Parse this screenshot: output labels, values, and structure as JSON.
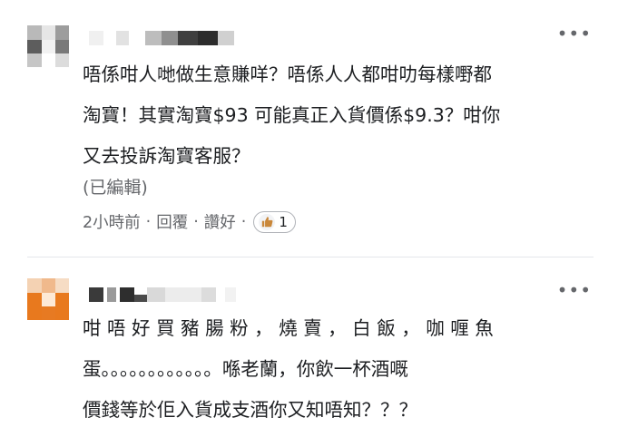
{
  "comments": [
    {
      "text_lines": [
        "唔係咁人哋做生意賺咩？唔係人人都咁叻每樣嘢都",
        "淘寶！其實淘寶$93  可能真正入貨價係$9.3？咁你",
        "又去投訴淘寶客服？"
      ],
      "edited_label": "(已編輯)",
      "time": "2小時前",
      "reply_label": "回覆",
      "like_label": "讚好",
      "separator": "·",
      "reaction_count": "1",
      "more_label": "•••"
    },
    {
      "text_lines": [
        "咁 唔 好 買 豬 腸 粉 ， 燒 賣 ， 白 飯 ， 咖 喱 魚",
        "蛋。。。。。。。。。。。。喺老蘭，你飲一杯酒嘅",
        "價錢等於佢入貨成支酒你又知唔知？？？"
      ],
      "more_label": "•••"
    }
  ],
  "colors": {
    "text": "#1c1e21",
    "meta": "#65676b",
    "avatar2_accent": "#e8791e",
    "reaction_thumb": "#c9873a"
  },
  "icons": [
    "like-thumb-icon",
    "more-options-icon"
  ]
}
